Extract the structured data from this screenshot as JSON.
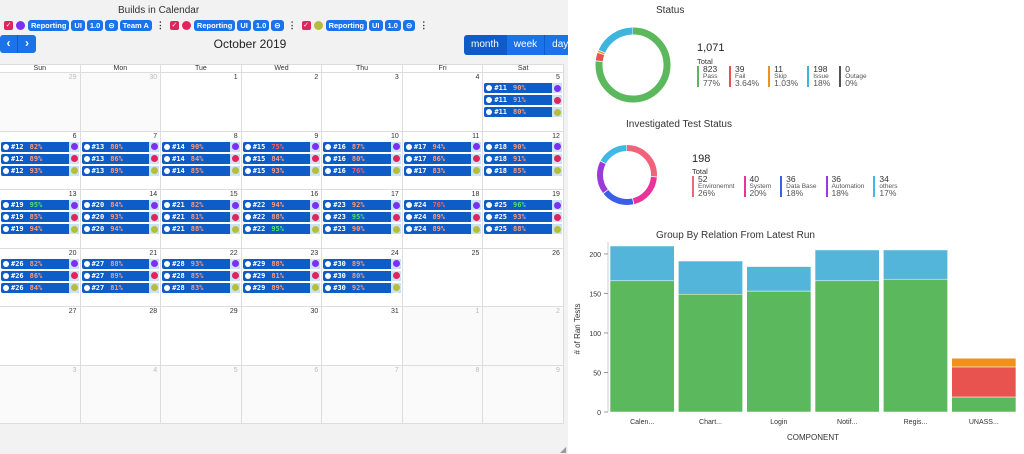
{
  "calendar": {
    "header_title": "Builds in Calendar",
    "month_title": "October 2019",
    "nav": {
      "prev": "‹",
      "next": "›"
    },
    "views": [
      "month",
      "week",
      "day"
    ],
    "filters": [
      {
        "dot": "#7b2ff7",
        "tags": [
          "Reporting",
          "UI",
          "1.0",
          "⊝",
          "Team A"
        ]
      },
      {
        "dot": "#e0245e",
        "tags": [
          "Reporting",
          "UI",
          "1.0",
          "⊝"
        ]
      },
      {
        "dot": "#b5bd3c",
        "tags": [
          "Reporting",
          "UI",
          "1.0",
          "⊝"
        ]
      }
    ],
    "weekdays": [
      "Sun",
      "Mon",
      "Tue",
      "Wed",
      "Thu",
      "Fri",
      "Sat"
    ],
    "weeks": [
      [
        {
          "d": "29",
          "o": true
        },
        {
          "d": "30",
          "o": true
        },
        {
          "d": "1"
        },
        {
          "d": "2"
        },
        {
          "d": "3"
        },
        {
          "d": "4"
        },
        {
          "d": "5",
          "ev": [
            [
              "#11",
              "90%",
              "#7b2ff7"
            ],
            [
              "#11",
              "91%",
              "#e0245e"
            ],
            [
              "#11",
              "80%",
              "#b5bd3c"
            ]
          ]
        }
      ],
      [
        {
          "d": "6",
          "ev": [
            [
              "#12",
              "82%",
              "#7b2ff7"
            ],
            [
              "#12",
              "89%",
              "#e0245e"
            ],
            [
              "#12",
              "93%",
              "#b5bd3c"
            ]
          ]
        },
        {
          "d": "7",
          "ev": [
            [
              "#13",
              "80%",
              "#7b2ff7"
            ],
            [
              "#13",
              "86%",
              "#e0245e"
            ],
            [
              "#13",
              "89%",
              "#b5bd3c"
            ]
          ]
        },
        {
          "d": "8",
          "ev": [
            [
              "#14",
              "90%",
              "#7b2ff7"
            ],
            [
              "#14",
              "84%",
              "#e0245e"
            ],
            [
              "#14",
              "85%",
              "#b5bd3c"
            ]
          ]
        },
        {
          "d": "9",
          "ev": [
            [
              "#15",
              "75%",
              "#7b2ff7"
            ],
            [
              "#15",
              "84%",
              "#e0245e"
            ],
            [
              "#15",
              "93%",
              "#b5bd3c"
            ]
          ]
        },
        {
          "d": "10",
          "ev": [
            [
              "#16",
              "87%",
              "#7b2ff7"
            ],
            [
              "#16",
              "80%",
              "#e0245e"
            ],
            [
              "#16",
              "76%",
              "#b5bd3c"
            ]
          ]
        },
        {
          "d": "11",
          "ev": [
            [
              "#17",
              "94%",
              "#7b2ff7"
            ],
            [
              "#17",
              "86%",
              "#e0245e"
            ],
            [
              "#17",
              "83%",
              "#b5bd3c"
            ]
          ]
        },
        {
          "d": "12",
          "ev": [
            [
              "#18",
              "90%",
              "#7b2ff7"
            ],
            [
              "#18",
              "91%",
              "#e0245e"
            ],
            [
              "#18",
              "85%",
              "#b5bd3c"
            ]
          ]
        }
      ],
      [
        {
          "d": "13",
          "ev": [
            [
              "#19",
              "95%",
              "#7b2ff7"
            ],
            [
              "#19",
              "85%",
              "#e0245e"
            ],
            [
              "#19",
              "94%",
              "#b5bd3c"
            ]
          ]
        },
        {
          "d": "14",
          "ev": [
            [
              "#20",
              "84%",
              "#7b2ff7"
            ],
            [
              "#20",
              "93%",
              "#e0245e"
            ],
            [
              "#20",
              "94%",
              "#b5bd3c"
            ]
          ]
        },
        {
          "d": "15",
          "ev": [
            [
              "#21",
              "82%",
              "#7b2ff7"
            ],
            [
              "#21",
              "81%",
              "#e0245e"
            ],
            [
              "#21",
              "88%",
              "#b5bd3c"
            ]
          ]
        },
        {
          "d": "16",
          "ev": [
            [
              "#22",
              "94%",
              "#7b2ff7"
            ],
            [
              "#22",
              "88%",
              "#e0245e"
            ],
            [
              "#22",
              "95%",
              "#b5bd3c"
            ]
          ]
        },
        {
          "d": "17",
          "ev": [
            [
              "#23",
              "92%",
              "#7b2ff7"
            ],
            [
              "#23",
              "95%",
              "#e0245e"
            ],
            [
              "#23",
              "90%",
              "#b5bd3c"
            ]
          ]
        },
        {
          "d": "18",
          "ev": [
            [
              "#24",
              "76%",
              "#7b2ff7"
            ],
            [
              "#24",
              "89%",
              "#e0245e"
            ],
            [
              "#24",
              "89%",
              "#b5bd3c"
            ]
          ]
        },
        {
          "d": "19",
          "ev": [
            [
              "#25",
              "96%",
              "#7b2ff7"
            ],
            [
              "#25",
              "93%",
              "#e0245e"
            ],
            [
              "#25",
              "88%",
              "#b5bd3c"
            ]
          ]
        }
      ],
      [
        {
          "d": "20",
          "ev": [
            [
              "#26",
              "82%",
              "#7b2ff7"
            ],
            [
              "#26",
              "86%",
              "#e0245e"
            ],
            [
              "#26",
              "84%",
              "#b5bd3c"
            ]
          ]
        },
        {
          "d": "21",
          "ev": [
            [
              "#27",
              "88%",
              "#7b2ff7"
            ],
            [
              "#27",
              "89%",
              "#e0245e"
            ],
            [
              "#27",
              "81%",
              "#b5bd3c"
            ]
          ]
        },
        {
          "d": "22",
          "ev": [
            [
              "#28",
              "93%",
              "#7b2ff7"
            ],
            [
              "#28",
              "85%",
              "#e0245e"
            ],
            [
              "#28",
              "83%",
              "#b5bd3c"
            ]
          ]
        },
        {
          "d": "23",
          "ev": [
            [
              "#29",
              "88%",
              "#7b2ff7"
            ],
            [
              "#29",
              "81%",
              "#e0245e"
            ],
            [
              "#29",
              "89%",
              "#b5bd3c"
            ]
          ]
        },
        {
          "d": "24",
          "ev": [
            [
              "#30",
              "89%",
              "#7b2ff7"
            ],
            [
              "#30",
              "80%",
              "#e0245e"
            ],
            [
              "#30",
              "92%",
              "#b5bd3c"
            ]
          ]
        },
        {
          "d": "25"
        },
        {
          "d": "26"
        }
      ],
      [
        {
          "d": "27"
        },
        {
          "d": "28"
        },
        {
          "d": "29"
        },
        {
          "d": "30"
        },
        {
          "d": "31"
        },
        {
          "d": "1",
          "o": true
        },
        {
          "d": "2",
          "o": true
        }
      ],
      [
        {
          "d": "3",
          "o": true
        },
        {
          "d": "4",
          "o": true
        },
        {
          "d": "5",
          "o": true
        },
        {
          "d": "6",
          "o": true
        },
        {
          "d": "7",
          "o": true
        },
        {
          "d": "8",
          "o": true
        },
        {
          "d": "9",
          "o": true
        }
      ]
    ]
  },
  "status": {
    "title": "Status",
    "total": "1,071",
    "total_label": "Total",
    "items": [
      {
        "value": "823",
        "label": "Pass",
        "pct": "77%",
        "color": "#5cb85c"
      },
      {
        "value": "39",
        "label": "Fail",
        "pct": "3.64%",
        "color": "#e9534f"
      },
      {
        "value": "11",
        "label": "Skip",
        "pct": "1.03%",
        "color": "#f0911c"
      },
      {
        "value": "198",
        "label": "Issue",
        "pct": "18%",
        "color": "#3fb4dc"
      },
      {
        "value": "0",
        "label": "Outage",
        "pct": "0%",
        "color": "#555555"
      }
    ]
  },
  "investigated": {
    "title": "Investigated Test Status",
    "total": "198",
    "total_label": "Total",
    "items": [
      {
        "value": "52",
        "label": "Environemnt",
        "pct": "26%",
        "color": "#f0637b"
      },
      {
        "value": "40",
        "label": "System",
        "pct": "20%",
        "color": "#e9339a"
      },
      {
        "value": "36",
        "label": "Data Base",
        "pct": "18%",
        "color": "#3a5ee8"
      },
      {
        "value": "36",
        "label": "Automation",
        "pct": "18%",
        "color": "#9a3ad8"
      },
      {
        "value": "34",
        "label": "others",
        "pct": "17%",
        "color": "#3fb8e8"
      }
    ]
  },
  "chart_data": {
    "type": "bar",
    "stacked": true,
    "title": "Group By Relation From Latest Run",
    "xlabel": "COMPONENT",
    "ylabel": "# of Ran Tests",
    "ylim": [
      0,
      210
    ],
    "yticks": [
      0,
      50,
      100,
      150,
      200
    ],
    "categories": [
      "Calen...",
      "Chart...",
      "Login",
      "Notif...",
      "Regis...",
      "UNASS..."
    ],
    "series": [
      {
        "color": "#5cb85c",
        "values": [
          166,
          149,
          153,
          166,
          168,
          19
        ]
      },
      {
        "color": "#e9534f",
        "values": [
          0,
          0,
          0,
          0,
          0,
          38
        ]
      },
      {
        "color": "#f0911c",
        "values": [
          0,
          0,
          0,
          0,
          0,
          11
        ]
      },
      {
        "color": "#52b5d9",
        "values": [
          44,
          42,
          31,
          39,
          37,
          0
        ]
      }
    ]
  }
}
